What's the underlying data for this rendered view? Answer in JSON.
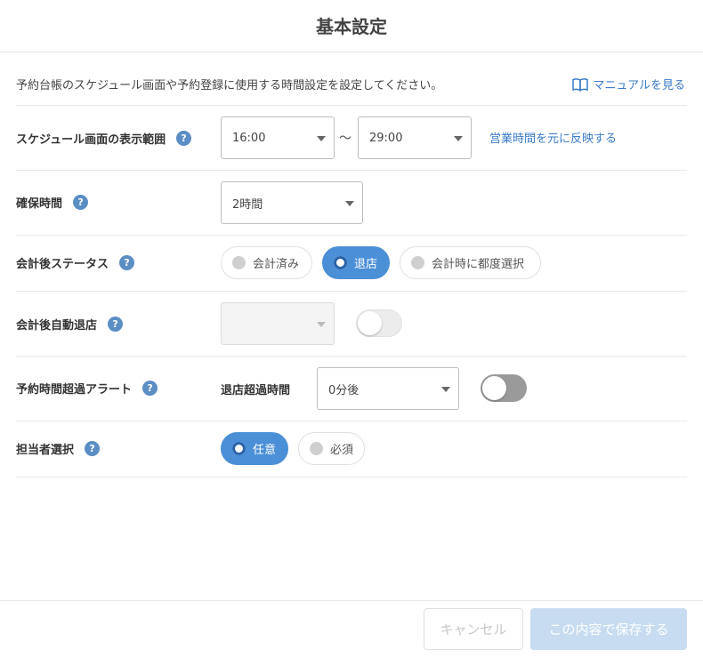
{
  "title": "基本設定",
  "intro": "予約台帳のスケジュール画面や予約登録に使用する時間設定を設定してください。",
  "manual_link": {
    "label": "マニュアルを見る",
    "icon": "book-icon"
  },
  "help_glyph": "?",
  "schedule_range": {
    "label": "スケジュール画面の表示範囲",
    "start": "16:00",
    "separator": "〜",
    "end": "29:00",
    "link": "営業時間を元に反映する"
  },
  "hold_time": {
    "label": "確保時間",
    "value": "2時間"
  },
  "post_checkout_status": {
    "label": "会計後ステータス",
    "options": [
      {
        "label": "会計済み",
        "selected": false
      },
      {
        "label": "退店",
        "selected": true
      },
      {
        "label": "会計時に都度選択",
        "selected": false
      }
    ]
  },
  "auto_leave": {
    "label": "会計後自動退店",
    "value": "",
    "enabled": false
  },
  "overtime_alert": {
    "label": "予約時間超過アラート",
    "sub_label": "退店超過時間",
    "value": "0分後",
    "enabled": false
  },
  "staff_selection": {
    "label": "担当者選択",
    "options": [
      {
        "label": "任意",
        "selected": true
      },
      {
        "label": "必須",
        "selected": false
      }
    ]
  },
  "footer": {
    "cancel": "キャンセル",
    "save": "この内容で保存する"
  },
  "colors": {
    "accent": "#4b8fd6",
    "link": "#3a7bc8",
    "help": "#5b8ec4"
  }
}
